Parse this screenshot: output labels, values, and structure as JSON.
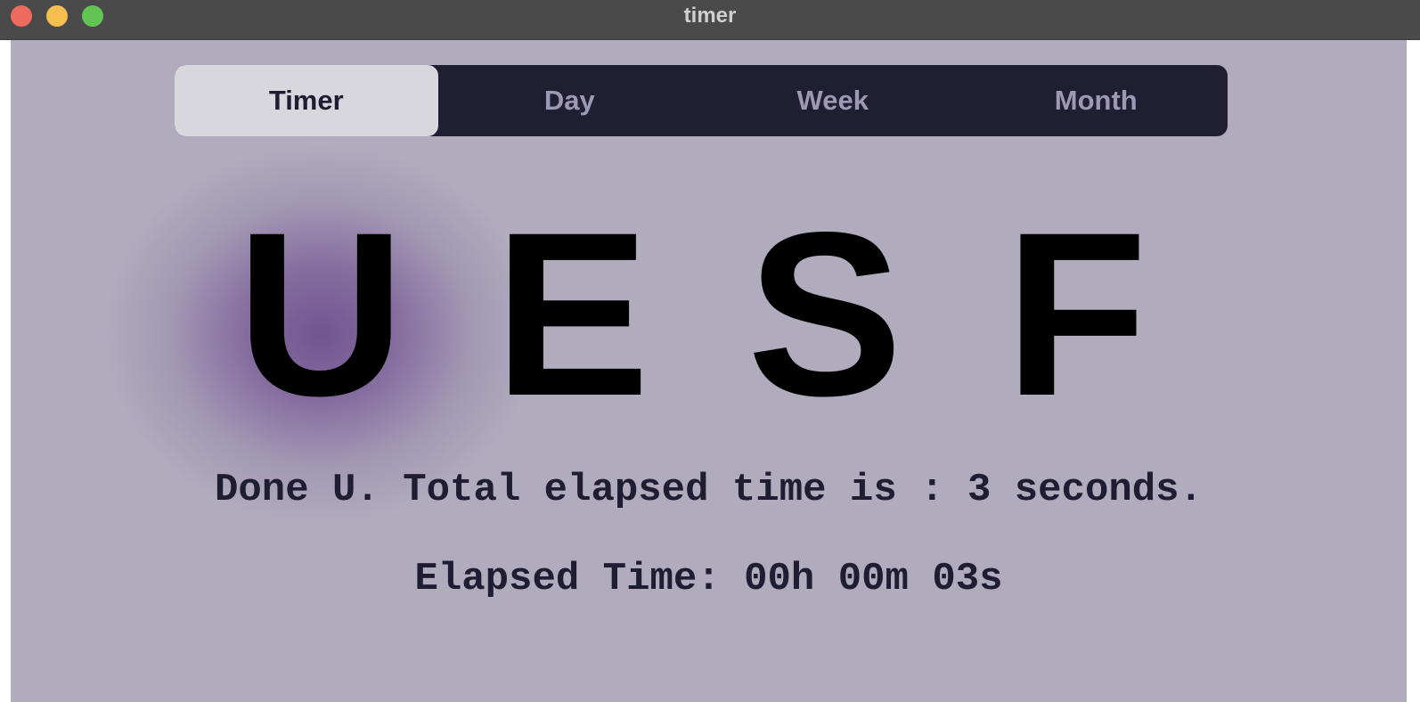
{
  "window": {
    "title": "timer"
  },
  "tabs": [
    {
      "label": "Timer",
      "active": true
    },
    {
      "label": "Day",
      "active": false
    },
    {
      "label": "Week",
      "active": false
    },
    {
      "label": "Month",
      "active": false
    }
  ],
  "letters": [
    "U",
    "E",
    "S",
    "F"
  ],
  "highlighted_letter": "U",
  "status": {
    "done_message": "Done U. Total elapsed time is : 3 seconds.",
    "elapsed_message": "Elapsed Time: 00h 00m 03s"
  },
  "colors": {
    "background": "#b0acbe",
    "tab_bar": "#201e33",
    "tab_active": "#d8d7dd",
    "glow": "#725591",
    "text": "#1f1d33"
  }
}
